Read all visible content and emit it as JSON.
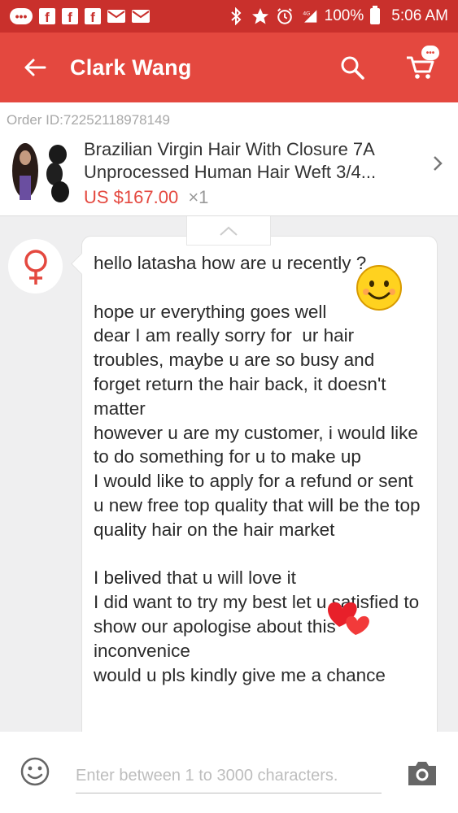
{
  "status_bar": {
    "battery": "100%",
    "time": "5:06 AM",
    "network": "4G"
  },
  "app_bar": {
    "title": "Clark Wang"
  },
  "order": {
    "order_id": "Order ID:72252118978149",
    "product_title": "Brazilian Virgin Hair With Closure 7A Unprocessed Human Hair Weft 3/4...",
    "price": "US $167.00",
    "quantity": "×1"
  },
  "chat": {
    "message": "hello latasha how are u recently ?\n\nhope ur everything goes well\ndear I am really sorry for  ur hair troubles, maybe u are so busy and forget return the hair back, it doesn't matter\nhowever u are my customer, i would like to do something for u to make up\nI would like to apply for a refund or sent u new free top quality that will be the top quality hair on the hair market\n\nI belived that u will love it\nI did want to try my best let u satisfied to show our apologise about this inconvenice\nwould u pls kindly give me a chance"
  },
  "input": {
    "placeholder": "Enter between 1 to 3000 characters."
  },
  "colors": {
    "status_bar": "#c9302c",
    "app_bar": "#e4483f",
    "price": "#e4483f"
  }
}
